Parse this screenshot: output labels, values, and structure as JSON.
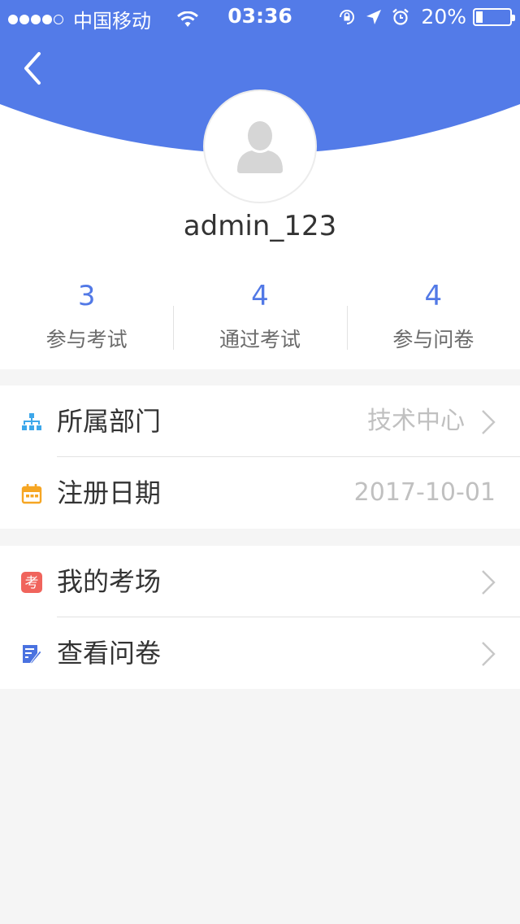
{
  "status_bar": {
    "carrier": "中国移动",
    "time": "03:36",
    "battery_percent": "20%",
    "battery_level": 0.2,
    "signal_bars_filled": 4,
    "signal_bars_total": 5
  },
  "colors": {
    "header_blue": "#537be8",
    "stat_blue": "#5279e6",
    "dept_icon": "#3da7ea",
    "date_icon": "#f6a623",
    "exam_icon": "#f0645c",
    "survey_icon": "#4a72e0"
  },
  "header": {
    "back_icon": "chevron-left-icon"
  },
  "profile": {
    "avatar_icon": "user-silhouette-icon",
    "username": "admin_123"
  },
  "stats": [
    {
      "value": "3",
      "label": "参与考试"
    },
    {
      "value": "4",
      "label": "通过考试"
    },
    {
      "value": "4",
      "label": "参与问卷"
    }
  ],
  "info_group": {
    "department": {
      "label": "所属部门",
      "value": "技术中心",
      "icon": "org-chart-icon"
    },
    "register_date": {
      "label": "注册日期",
      "value": "2017-10-01",
      "icon": "calendar-icon"
    }
  },
  "menu_group": {
    "my_exams": {
      "label": "我的考场",
      "icon": "exam-badge-icon",
      "icon_text": "考"
    },
    "view_surveys": {
      "label": "查看问卷",
      "icon": "edit-note-icon"
    }
  }
}
